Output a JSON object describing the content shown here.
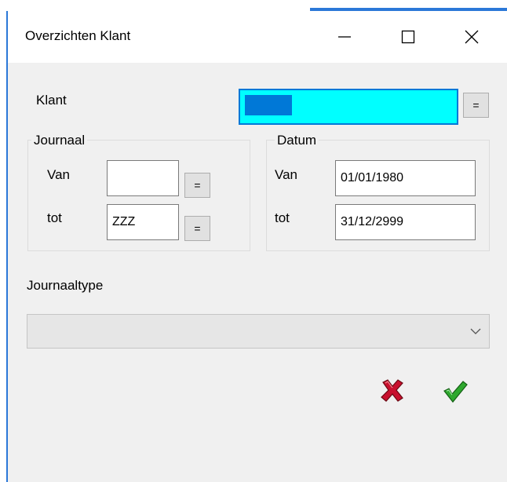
{
  "window": {
    "title": "Overzichten Klant"
  },
  "klant": {
    "label": "Klant",
    "button_label": "="
  },
  "journaal": {
    "legend": "Journaal",
    "van_label": "Van",
    "van_value": "",
    "van_button": "=",
    "tot_label": "tot",
    "tot_value": "ZZZ",
    "tot_button": "="
  },
  "datum": {
    "legend": "Datum",
    "van_label": "Van",
    "van_value": "01/01/1980",
    "tot_label": "tot",
    "tot_value": "31/12/2999"
  },
  "journaaltype": {
    "label": "Journaaltype",
    "selected": ""
  },
  "icons": {
    "minimize": "minimize-icon",
    "maximize": "maximize-icon",
    "close": "close-icon",
    "cancel": "red-x-icon",
    "confirm": "green-checkmark-icon",
    "dropdown": "chevron-down-icon"
  },
  "colors": {
    "klant_field_bg": "#00ffff",
    "selection": "#0078d7",
    "accent_border": "#2b78d8",
    "cancel": "#c8102e",
    "confirm": "#2ea82e"
  }
}
